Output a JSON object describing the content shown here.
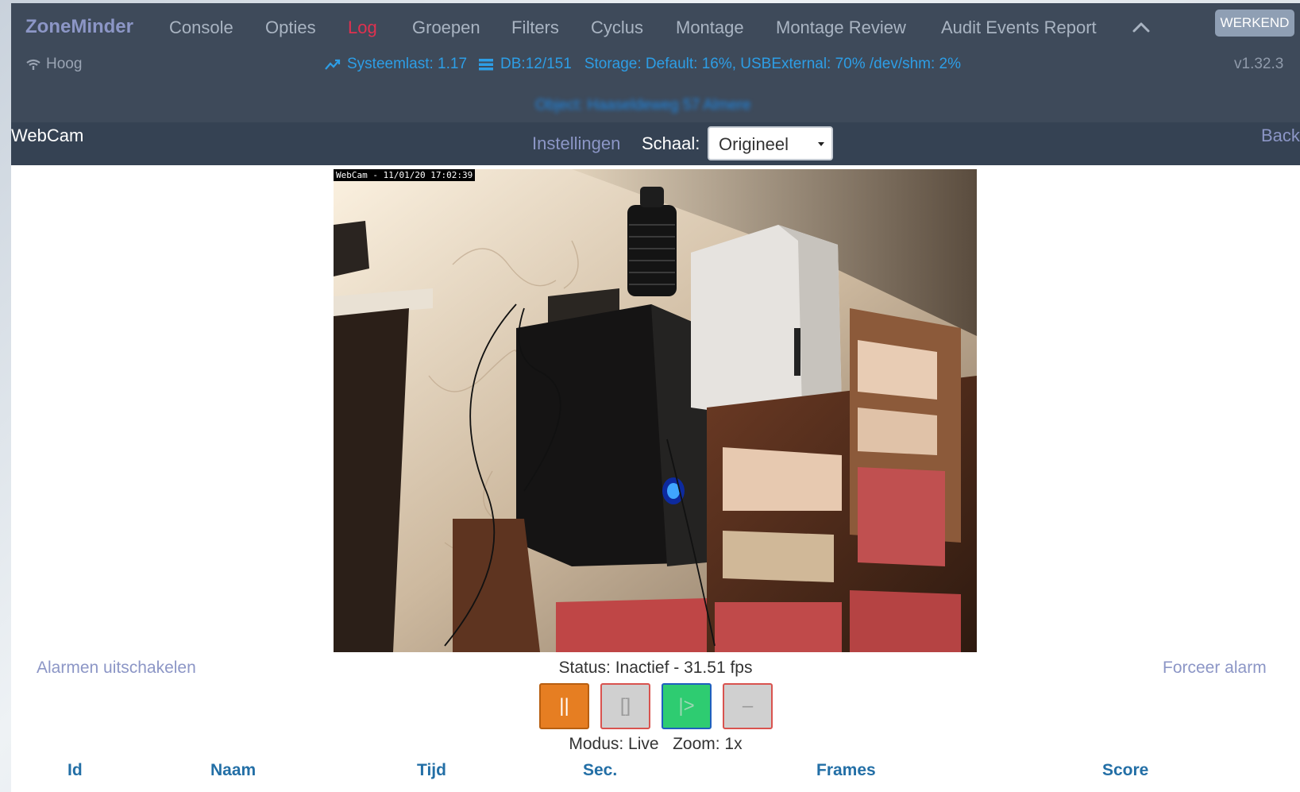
{
  "header": {
    "brand": "ZoneMinder",
    "nav": [
      {
        "label": "Console"
      },
      {
        "label": "Opties"
      },
      {
        "label": "Log",
        "active": true
      },
      {
        "label": "Groepen"
      },
      {
        "label": "Filters"
      },
      {
        "label": "Cyclus"
      },
      {
        "label": "Montage"
      },
      {
        "label": "Montage Review"
      },
      {
        "label": "Audit Events Report"
      }
    ],
    "run_state": "WERKEND",
    "bandwidth": "Hoog",
    "system_load": "Systeemlast: 1.17",
    "db": "DB:12/151",
    "storage": "Storage: Default: 16%, USBExternal: 70% /dev/shm: 2%",
    "version": "v1.32.3",
    "blurred_link": "Object: Haaseldeweg 57 Almere",
    "colors": {
      "accent": "#8c96c6",
      "active": "#e0314f",
      "info": "#2d9ee6"
    }
  },
  "toolbar": {
    "monitor_name": "WebCam",
    "settings": "Instellingen",
    "scale_label": "Schaal:",
    "scale_value": "Origineel",
    "back": "Back"
  },
  "feed": {
    "timestamp": "WebCam - 11/01/20 17:02:39"
  },
  "monitor": {
    "alarm_off": "Alarmen uitschakelen",
    "force_alarm": "Forceer alarm",
    "status": "Status: Inactief - 31.51 fps",
    "mode": "Modus: Live   Zoom: 1x"
  },
  "controls": {
    "pause": "||",
    "stop": "[]",
    "play": "|>",
    "fast": "–"
  },
  "table": {
    "columns": [
      "Id",
      "Naam",
      "Tijd",
      "Sec.",
      "Frames",
      "Score"
    ]
  }
}
